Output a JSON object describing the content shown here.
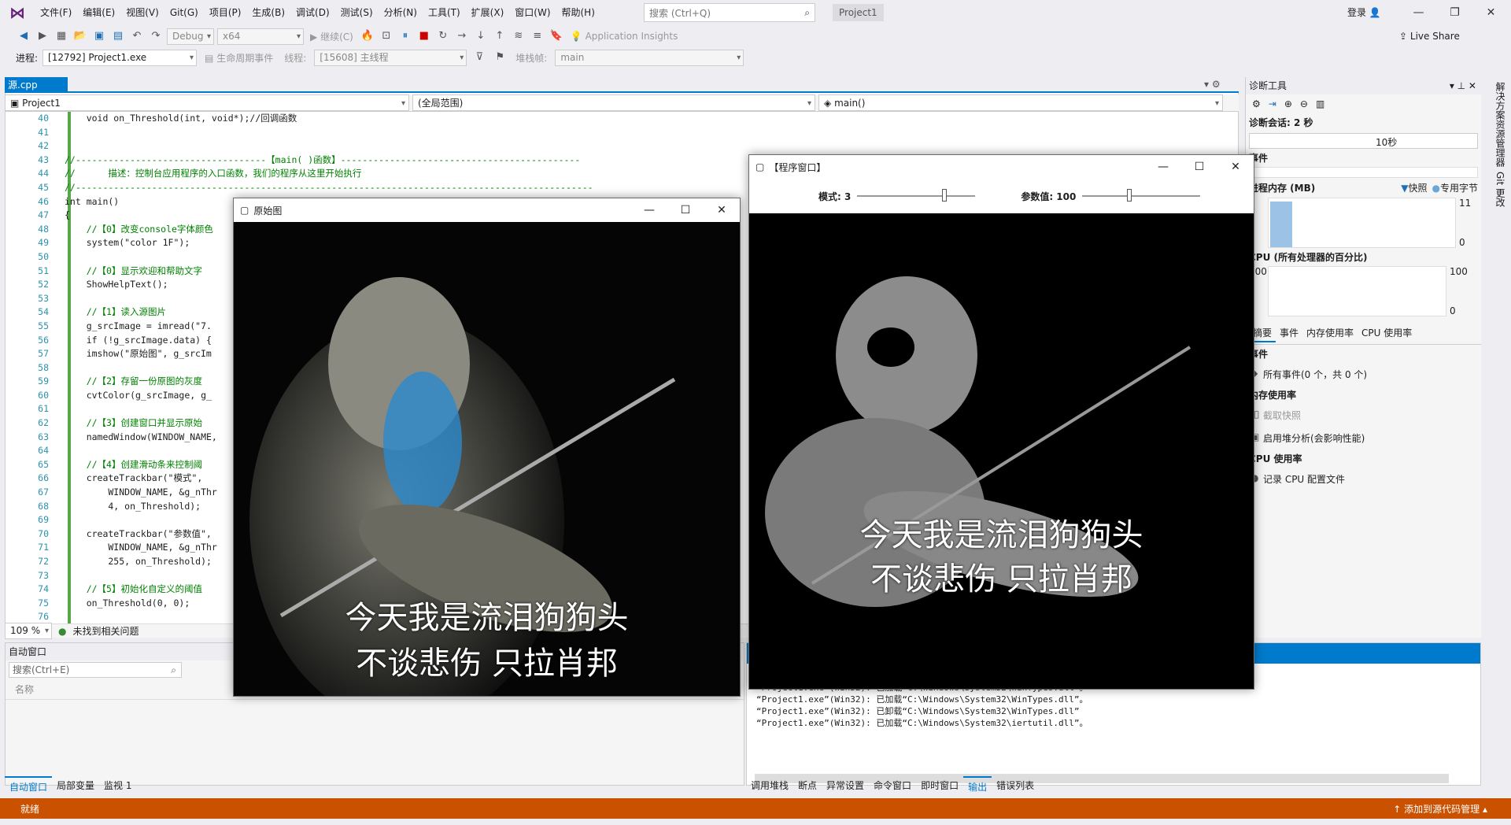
{
  "menubar": {
    "items": [
      "文件(F)",
      "编辑(E)",
      "视图(V)",
      "Git(G)",
      "项目(P)",
      "生成(B)",
      "调试(D)",
      "测试(S)",
      "分析(N)",
      "工具(T)",
      "扩展(X)",
      "窗口(W)",
      "帮助(H)"
    ],
    "search_placeholder": "搜索 (Ctrl+Q)",
    "project_title": "Project1",
    "login": "登录"
  },
  "toolbar1": {
    "config": "Debug",
    "platform": "x64",
    "continue": "继续(C)",
    "app_insights": "Application Insights",
    "live_share": "Live Share"
  },
  "toolbar2": {
    "process_label": "进程:",
    "process_value": "[12792] Project1.exe",
    "lifecycle": "生命周期事件",
    "thread_label": "线程:",
    "thread_value": "[15608] 主线程",
    "stack_label": "堆栈帧:",
    "stack_value": "main"
  },
  "editor": {
    "tab": "源.cpp",
    "nav_project": "Project1",
    "nav_scope": "(全局范围)",
    "nav_func": "main()",
    "zoom": "109 %",
    "issues": "未找到相关问题",
    "lines": [
      {
        "n": "40",
        "t": "    void on_Threshold(int, void*);//回调函数",
        "c": ""
      },
      {
        "n": "41",
        "t": "",
        "c": ""
      },
      {
        "n": "42",
        "t": "",
        "c": ""
      },
      {
        "n": "43",
        "t": "//-----------------------------------【main( )函数】--------------------------------------------",
        "c": "cmt"
      },
      {
        "n": "44",
        "t": "//      描述：控制台应用程序的入口函数，我们的程序从这里开始执行",
        "c": "cmt"
      },
      {
        "n": "45",
        "t": "//-----------------------------------------------------------------------------------------------",
        "c": "cmt"
      },
      {
        "n": "46",
        "t": "int main()",
        "c": ""
      },
      {
        "n": "47",
        "t": "{",
        "c": ""
      },
      {
        "n": "48",
        "t": "    //【0】改变console字体颜色",
        "c": "cmt"
      },
      {
        "n": "49",
        "t": "    system(\"color 1F\");",
        "c": ""
      },
      {
        "n": "50",
        "t": "",
        "c": ""
      },
      {
        "n": "51",
        "t": "    //【0】显示欢迎和帮助文字",
        "c": "cmt"
      },
      {
        "n": "52",
        "t": "    ShowHelpText();",
        "c": ""
      },
      {
        "n": "53",
        "t": "",
        "c": ""
      },
      {
        "n": "54",
        "t": "    //【1】读入源图片",
        "c": "cmt"
      },
      {
        "n": "55",
        "t": "    g_srcImage = imread(\"7.",
        "c": ""
      },
      {
        "n": "56",
        "t": "    if (!g_srcImage.data) {",
        "c": ""
      },
      {
        "n": "57",
        "t": "    imshow(\"原始图\", g_srcIm",
        "c": ""
      },
      {
        "n": "58",
        "t": "",
        "c": ""
      },
      {
        "n": "59",
        "t": "    //【2】存留一份原图的灰度",
        "c": "cmt"
      },
      {
        "n": "60",
        "t": "    cvtColor(g_srcImage, g_",
        "c": ""
      },
      {
        "n": "61",
        "t": "",
        "c": ""
      },
      {
        "n": "62",
        "t": "    //【3】创建窗口并显示原始",
        "c": "cmt"
      },
      {
        "n": "63",
        "t": "    namedWindow(WINDOW_NAME,",
        "c": ""
      },
      {
        "n": "64",
        "t": "",
        "c": ""
      },
      {
        "n": "65",
        "t": "    //【4】创建滑动条来控制阈",
        "c": "cmt"
      },
      {
        "n": "66",
        "t": "    createTrackbar(\"模式\",",
        "c": ""
      },
      {
        "n": "67",
        "t": "        WINDOW_NAME, &g_nThr",
        "c": ""
      },
      {
        "n": "68",
        "t": "        4, on_Threshold);",
        "c": ""
      },
      {
        "n": "69",
        "t": "",
        "c": ""
      },
      {
        "n": "70",
        "t": "    createTrackbar(\"参数值\",",
        "c": ""
      },
      {
        "n": "71",
        "t": "        WINDOW_NAME, &g_nThr",
        "c": ""
      },
      {
        "n": "72",
        "t": "        255, on_Threshold);",
        "c": ""
      },
      {
        "n": "73",
        "t": "",
        "c": ""
      },
      {
        "n": "74",
        "t": "    //【5】初始化自定义的阈值",
        "c": "cmt"
      },
      {
        "n": "75",
        "t": "    on_Threshold(0, 0);",
        "c": ""
      },
      {
        "n": "76",
        "t": "",
        "c": ""
      }
    ]
  },
  "diagnostics": {
    "title": "诊断工具",
    "session": "诊断会话: 2 秒",
    "timeline": "10秒",
    "events": "事件",
    "memory": "进程内存 (MB)",
    "snapshot": "快照",
    "private": "专用字节",
    "mem_max": "11",
    "mem_min": "0",
    "cpu": "CPU (所有处理器的百分比)",
    "cpu_max": "100",
    "cpu_min": "0",
    "tabs": [
      "摘要",
      "事件",
      "内存使用率",
      "CPU 使用率"
    ],
    "sec_events": "事件",
    "all_events": "所有事件(0 个，共 0 个)",
    "sec_memory": "内存使用率",
    "take_snapshot": "截取快照",
    "heap": "启用堆分析(会影响性能)",
    "sec_cpu": "CPU 使用率",
    "record_cpu": "记录 CPU 配置文件"
  },
  "autos": {
    "title": "自动窗口",
    "search": "搜索(Ctrl+E)",
    "col_name": "名称"
  },
  "output": {
    "lines": [
      "“Project1.exe”(Win32): 已加载“C:\\Windows\\System32\\ntmarta.dll”。",
      "“Project1.exe”(Win32): 已加载“C:\\Windows\\System32\\WinTypes.dll”。",
      "“Project1.exe”(Win32): 已加载“C:\\Windows\\System32\\WinTypes.dll”。",
      "“Project1.exe”(Win32): 已卸载“C:\\Windows\\System32\\WinTypes.dll”",
      "“Project1.exe”(Win32): 已加载“C:\\Windows\\System32\\iertutil.dll”。"
    ]
  },
  "bottom_tabs_left": [
    "自动窗口",
    "局部变量",
    "监视 1"
  ],
  "bottom_tabs_right": [
    "调用堆栈",
    "断点",
    "异常设置",
    "命令窗口",
    "即时窗口",
    "输出",
    "错误列表"
  ],
  "status": {
    "ready": "就绪",
    "source_control": "添加到源代码管理"
  },
  "right_strip": [
    "解决方案资源管理器",
    "Git 更改"
  ],
  "win_original": {
    "title": "原始图",
    "caption1": "今天我是流泪狗狗头",
    "caption2": "不谈悲伤 只拉肖邦"
  },
  "win_program": {
    "title": "【程序窗口】",
    "mode_label": "模式: 3",
    "param_label": "参数值: 100",
    "mode_level": 0.75,
    "param_level": 0.39,
    "caption1": "今天我是流泪狗狗头",
    "caption2": "不谈悲伤 只拉肖邦"
  }
}
